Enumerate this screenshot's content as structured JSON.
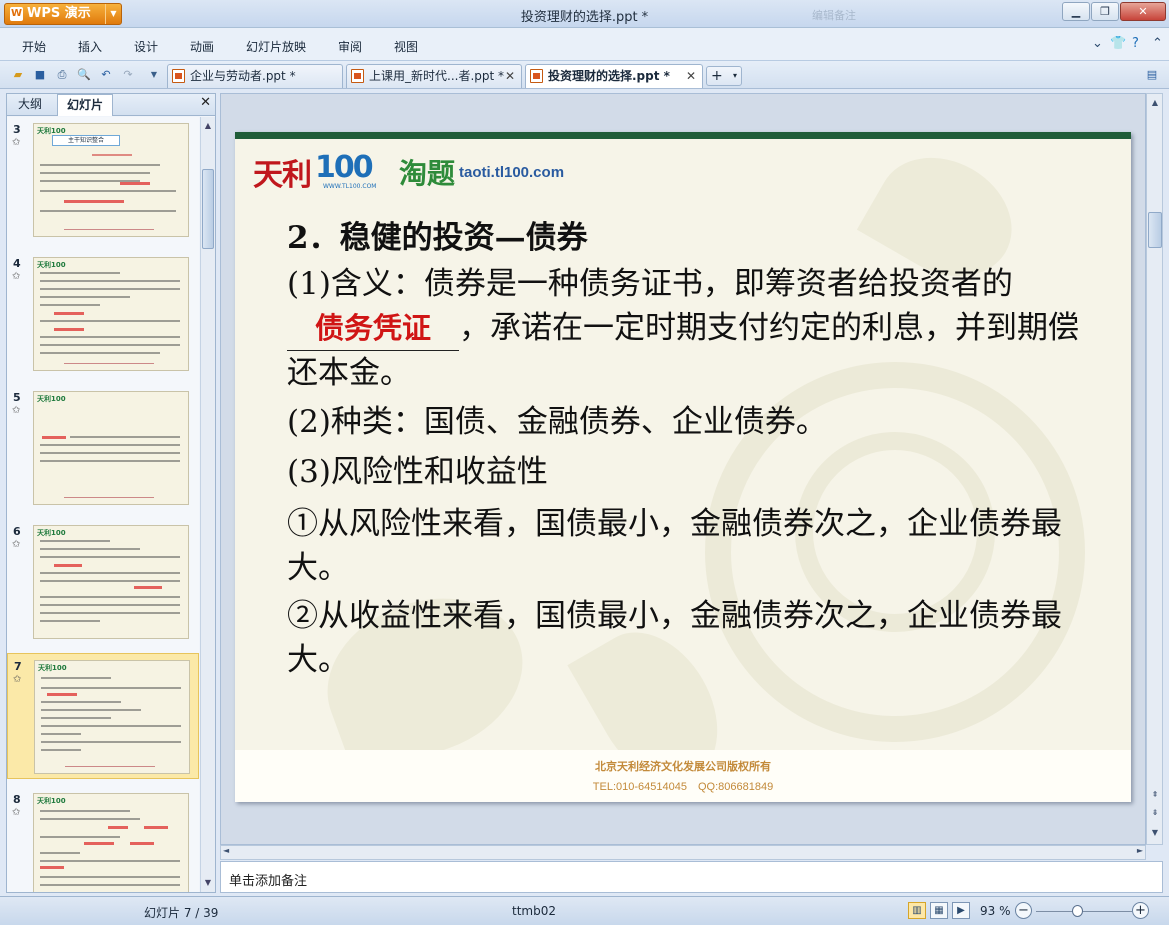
{
  "app": {
    "name": "WPS 演示",
    "title": "投资理财的选择.ppt *",
    "title_faint": "编辑备注",
    "window_controls": [
      "minimize-icon",
      "restore-icon",
      "close-icon"
    ]
  },
  "menu": {
    "items": [
      "开始",
      "插入",
      "设计",
      "动画",
      "幻灯片放映",
      "审阅",
      "视图"
    ]
  },
  "tabs": [
    {
      "label": "企业与劳动者.ppt *",
      "active": false
    },
    {
      "label": "上课用_新时代...者.ppt *",
      "active": false
    },
    {
      "label": "投资理财的选择.ppt *",
      "active": true
    }
  ],
  "left_panel": {
    "tabs": [
      "大纲",
      "幻灯片"
    ],
    "active_tab": "幻灯片",
    "thumbnails": [
      {
        "num": "3",
        "box": "主干知识整合"
      },
      {
        "num": "4"
      },
      {
        "num": "5"
      },
      {
        "num": "6"
      },
      {
        "num": "7",
        "selected": true
      },
      {
        "num": "8"
      }
    ]
  },
  "slide": {
    "logo_tianli": "天利",
    "logo_100": "100",
    "logo_sub": "WWW.TL100.COM",
    "logo_taoti": "淘题",
    "logo_url": "taoti.tl100.com",
    "heading": "2．稳健的投资—债券",
    "p1_before": "(1)含义：债券是一种债务证书，即筹资者给投资者的",
    "p1_answer": "债务凭证",
    "p1_after": "，承诺在一定时期支付约定的利息，并到期偿还本金。",
    "p2": "(2)种类：国债、金融债券、企业债券。",
    "p3": "(3)风险性和收益性",
    "p4": "①从风险性来看，国债最小，金融债券次之，企业债券最大。",
    "p5": "②从收益性来看，国债最小，金融债券次之，企业债券最大。",
    "footer_company": "北京天利经济文化发展公司版权所有",
    "footer_contact": "TEL:010-64514045　QQ:806681849",
    "colors": {
      "answer": "#d01515",
      "topbar": "#1f5c38",
      "footer": "#c38a3a"
    }
  },
  "notes": {
    "placeholder": "单击添加备注"
  },
  "status": {
    "slide_counter": "幻灯片 7 / 39",
    "template": "ttmb02",
    "zoom": "93 %",
    "zoom_value": 93
  }
}
